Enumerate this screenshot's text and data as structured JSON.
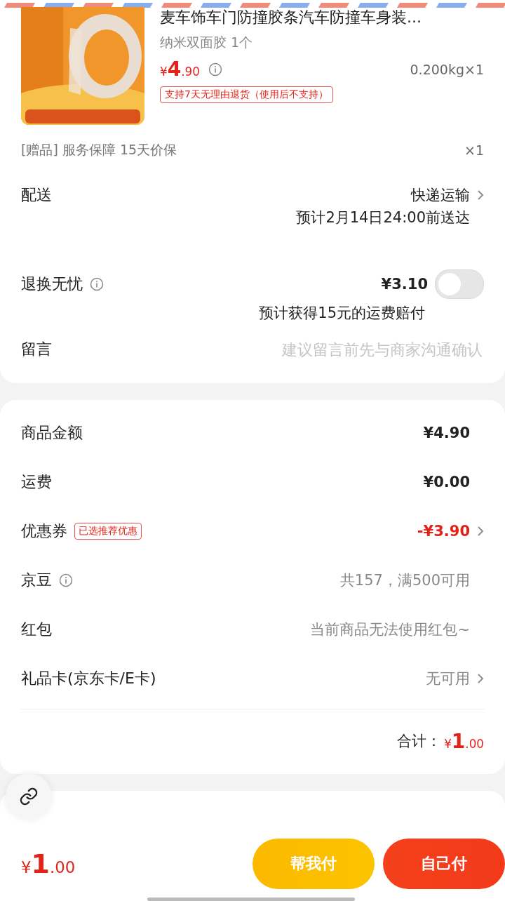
{
  "product": {
    "title": "麦车饰车门防撞胶条汽车防撞车身装...",
    "spec": "纳米双面胶 1个",
    "price": "¥4.90",
    "weight_qty": "0.200kg×1",
    "return_policy": "支持7天无理由退货（使用后不支持）"
  },
  "gift": {
    "label": "[赠品] 服务保障 15天价保",
    "qty": "×1"
  },
  "delivery": {
    "label": "配送",
    "method": "快递运输",
    "eta": "预计2月14日24:00前送达"
  },
  "return_insurance": {
    "label": "退换无忧",
    "price": "¥3.10",
    "on": false,
    "note": "预计获得15元的运费赔付"
  },
  "message": {
    "label": "留言",
    "placeholder": "建议留言前先与商家沟通确认"
  },
  "fees": [
    {
      "label": "商品金额",
      "value": "¥4.90",
      "kind": "strong",
      "info": false,
      "chevron": false
    },
    {
      "label": "运费",
      "value": "¥0.00",
      "kind": "strong",
      "info": false,
      "chevron": false
    },
    {
      "label": "优惠券",
      "tag": "已选推荐优惠",
      "value": "-¥3.90",
      "kind": "discount",
      "info": false,
      "chevron": true
    },
    {
      "label": "京豆",
      "value": "共157，满500可用",
      "kind": "muted",
      "info": true,
      "chevron": false
    },
    {
      "label": "红包",
      "value": "当前商品无法使用红包~",
      "kind": "muted",
      "info": false,
      "chevron": false
    },
    {
      "label": "礼品卡(京东卡/E卡)",
      "value": "无可用",
      "kind": "muted",
      "info": false,
      "chevron": true
    }
  ],
  "total": {
    "label": "合计：",
    "amount": "¥1.00"
  },
  "bottom_bar": {
    "amount": "¥1.00",
    "buttons": [
      {
        "label": "帮我付",
        "kind": "secondary"
      },
      {
        "label": "自己付",
        "kind": "primary"
      }
    ]
  }
}
